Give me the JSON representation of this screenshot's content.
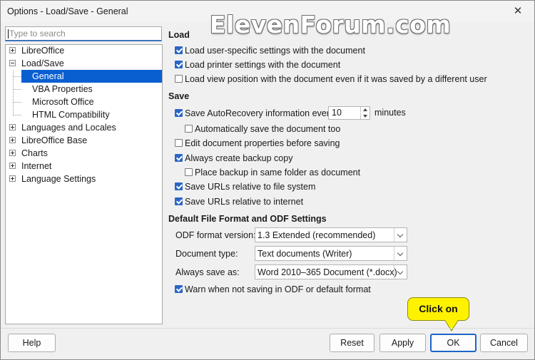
{
  "window": {
    "title": "Options - Load/Save - General",
    "close_glyph": "✕"
  },
  "watermark": "ElevenForum.com",
  "search": {
    "placeholder": "Type to search"
  },
  "tree": [
    {
      "label": "LibreOffice",
      "expander": "plus"
    },
    {
      "label": "Load/Save",
      "expander": "minus"
    },
    {
      "label": "General",
      "selected": true
    },
    {
      "label": "VBA Properties"
    },
    {
      "label": "Microsoft Office"
    },
    {
      "label": "HTML Compatibility"
    },
    {
      "label": "Languages and Locales",
      "expander": "plus"
    },
    {
      "label": "LibreOffice Base",
      "expander": "plus"
    },
    {
      "label": "Charts",
      "expander": "plus"
    },
    {
      "label": "Internet",
      "expander": "plus"
    },
    {
      "label": "Language Settings",
      "expander": "plus"
    }
  ],
  "load": {
    "heading": "Load",
    "items": [
      {
        "label": "Load user-specific settings with the document",
        "checked": true
      },
      {
        "label": "Load printer settings with the document",
        "checked": true
      },
      {
        "label": "Load view position with the document even if it was saved by a different user",
        "checked": false
      }
    ]
  },
  "save": {
    "heading": "Save",
    "autorecovery_label": "Save AutoRecovery information every:",
    "autorecovery_checked": true,
    "autorecovery_value": "10",
    "autorecovery_unit": "minutes",
    "items": [
      {
        "label": "Automatically save the document too",
        "checked": false
      },
      {
        "label": "Edit document properties before saving",
        "checked": false
      },
      {
        "label": "Always create backup copy",
        "checked": true
      },
      {
        "label": "Place backup in same folder as document",
        "checked": false
      },
      {
        "label": "Save URLs relative to file system",
        "checked": true
      },
      {
        "label": "Save URLs relative to internet",
        "checked": true
      }
    ]
  },
  "format": {
    "heading": "Default File Format and ODF Settings",
    "odf_label": "ODF format version:",
    "odf_value": "1.3 Extended (recommended)",
    "doctype_label": "Document type:",
    "doctype_value": "Text documents (Writer)",
    "saveas_label": "Always save as:",
    "saveas_value": "Word 2010–365 Document (*.docx)",
    "warn_label": "Warn when not saving in ODF or default format",
    "warn_checked": true
  },
  "buttons": {
    "help": "Help",
    "reset": "Reset",
    "apply": "Apply",
    "ok": "OK",
    "cancel": "Cancel"
  },
  "callout": "Click on",
  "colors": {
    "selection": "#0a5fd0",
    "checkbox": "#2b66c4",
    "callout": "#fff200",
    "default_button_border": "#1d64c9"
  }
}
